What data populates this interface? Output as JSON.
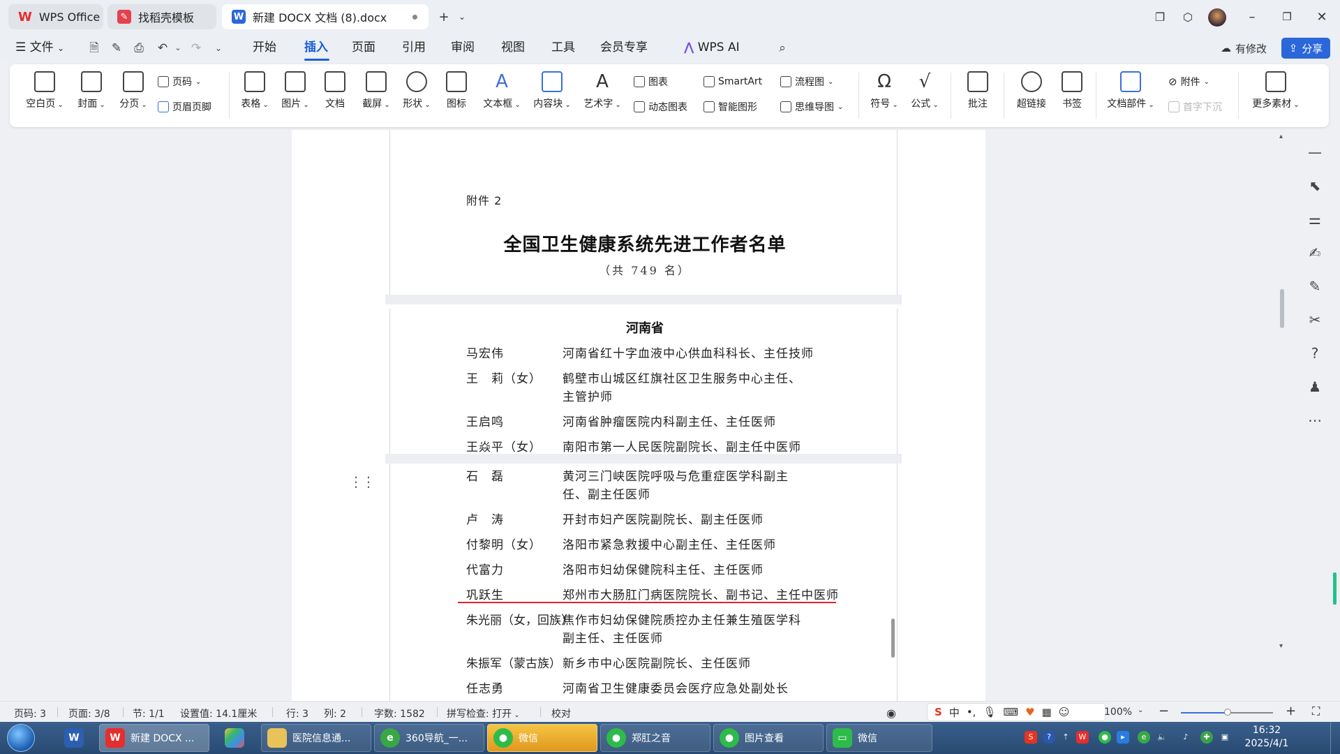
{
  "tabs": [
    {
      "label": "WPS Office"
    },
    {
      "label": "找稻壳模板"
    },
    {
      "label": "新建 DOCX 文档 (8).docx"
    }
  ],
  "menu": {
    "file": "文件",
    "items": [
      "开始",
      "插入",
      "页面",
      "引用",
      "审阅",
      "视图",
      "工具",
      "会员专享"
    ],
    "active": "插入",
    "wps_ai": "WPS AI",
    "modified": "有修改",
    "share": "分享"
  },
  "ribbon": {
    "blank_page": "空白页",
    "cover": "封面",
    "page_break": "分页",
    "page_number": "页码",
    "header_footer": "页眉页脚",
    "table": "表格",
    "picture": "图片",
    "document": "文档",
    "screenshot": "截屏",
    "shape": "形状",
    "icon": "图标",
    "textbox": "文本框",
    "content_block": "内容块",
    "wordart": "艺术字",
    "chart": "图表",
    "dynamic_chart": "动态图表",
    "smartart": "SmartArt",
    "smart_shape": "智能图形",
    "flowchart": "流程图",
    "mindmap": "思维导图",
    "symbol": "符号",
    "formula": "公式",
    "comment": "批注",
    "hyperlink": "超链接",
    "bookmark": "书签",
    "doc_parts": "文档部件",
    "attachment": "附件",
    "drop_cap": "首字下沉",
    "more_materials": "更多素材"
  },
  "document": {
    "attachment_label": "附件 2",
    "title": "全国卫生健康系统先进工作者名单",
    "subtitle": "（共 749 名）",
    "province": "河南省",
    "rows": [
      {
        "name": "马宏伟",
        "title1": "河南省红十字血液中心供血科科长、主任技师",
        "title2": ""
      },
      {
        "name": "王　莉（女）",
        "title1": "鹤壁市山城区红旗社区卫生服务中心主任、",
        "title2": "主管护师"
      },
      {
        "name": "王启鸣",
        "title1": "河南省肿瘤医院内科副主任、主任医师",
        "title2": ""
      },
      {
        "name": "王焱平（女）",
        "title1": "南阳市第一人民医院副院长、副主任中医师",
        "title2": ""
      },
      {
        "name": "石　磊",
        "title1": "黄河三门峡医院呼吸与危重症医学科副主",
        "title2": "任、副主任医师"
      },
      {
        "name": "卢　涛",
        "title1": "开封市妇产医院副院长、副主任医师",
        "title2": ""
      },
      {
        "name": "付黎明（女）",
        "title1": "洛阳市紧急救援中心副主任、主任医师",
        "title2": ""
      },
      {
        "name": "代富力",
        "title1": "洛阳市妇幼保健院科主任、主任医师",
        "title2": ""
      },
      {
        "name": "巩跃生",
        "title1": "郑州市大肠肛门病医院院长、副书记、主任中医师",
        "title2": ""
      },
      {
        "name": "朱光丽（女，回族）",
        "title1": "焦作市妇幼保健院质控办主任兼生殖医学科",
        "title2": "副主任、主任医师"
      },
      {
        "name": "朱振军（蒙古族）",
        "title1": "新乡市中心医院副院长、主任医师",
        "title2": ""
      },
      {
        "name": "任志勇",
        "title1": "河南省卫生健康委员会医疗应急处副处长",
        "title2": ""
      }
    ]
  },
  "status": {
    "page_code": "页码: 3",
    "page": "页面: 3/8",
    "section": "节: 1/1",
    "setting": "设置值: 14.1厘米",
    "row": "行: 3",
    "col": "列: 2",
    "word_count": "字数: 1582",
    "spell_check": "拼写检查: 打开",
    "proofread": "校对",
    "zoom": "100%"
  },
  "ime": {
    "chinese": "中"
  },
  "taskbar": {
    "items": [
      {
        "label": "新建 DOCX ..."
      },
      {
        "label": "医院信息通..."
      },
      {
        "label": "360导航_一..."
      },
      {
        "label": "微信"
      },
      {
        "label": "郑肛之音"
      },
      {
        "label": "图片查看"
      },
      {
        "label": "微信"
      }
    ],
    "time": "16:32",
    "date": "2025/4/1"
  },
  "colors": {
    "accent": "#1a5fd6",
    "underline": "#e0242e",
    "wps_red": "#e52e2e"
  }
}
